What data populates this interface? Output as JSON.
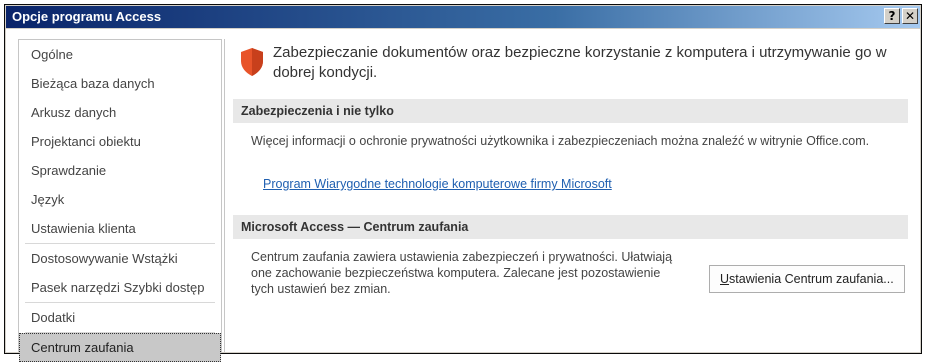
{
  "window": {
    "title": "Opcje programu Access"
  },
  "titlebar_buttons": {
    "help": "?",
    "close": "✕"
  },
  "sidebar": {
    "items": [
      {
        "label": "Ogólne"
      },
      {
        "label": "Bieżąca baza danych"
      },
      {
        "label": "Arkusz danych"
      },
      {
        "label": "Projektanci obiektu"
      },
      {
        "label": "Sprawdzanie"
      },
      {
        "label": "Język"
      },
      {
        "label": "Ustawienia klienta"
      },
      {
        "label": "Dostosowywanie Wstążki"
      },
      {
        "label": "Pasek narzędzi Szybki dostęp"
      },
      {
        "label": "Dodatki"
      },
      {
        "label": "Centrum zaufania"
      }
    ],
    "selected": "Centrum zaufania"
  },
  "main": {
    "header_icon": "shield-icon",
    "header_text": "Zabezpieczanie dokumentów oraz bezpieczne korzystanie z komputera i utrzymywanie go w dobrej kondycji.",
    "section1": {
      "title": "Zabezpieczenia i nie tylko",
      "text": "Więcej informacji o ochronie prywatności użytkownika i zabezpieczeniach można znaleźć w witrynie Office.com.",
      "link": "Program Wiarygodne technologie komputerowe firmy Microsoft"
    },
    "section2": {
      "title": "Microsoft Access — Centrum zaufania",
      "text": "Centrum zaufania zawiera ustawienia zabezpieczeń i prywatności. Ułatwiają one zachowanie bezpieczeństwa komputera. Zalecane jest pozostawienie tych ustawień bez zmian.",
      "button_first": "U",
      "button_rest": "stawienia Centrum zaufania..."
    }
  },
  "colors": {
    "titlebar": "#0a246a",
    "shield": "#e8542a",
    "link": "#1f5fb0"
  }
}
